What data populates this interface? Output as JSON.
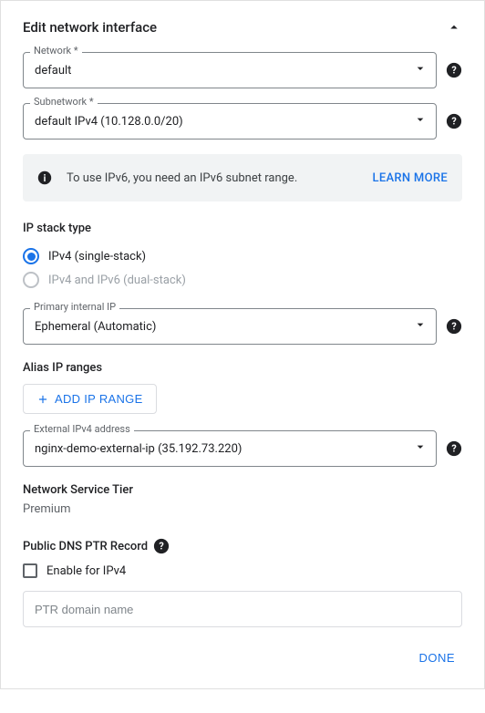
{
  "header": {
    "title": "Edit network interface"
  },
  "network": {
    "label": "Network *",
    "value": "default"
  },
  "subnetwork": {
    "label": "Subnetwork *",
    "value": "default IPv4 (10.128.0.0/20)"
  },
  "banner": {
    "text": "To use IPv6, you need an IPv6 subnet range.",
    "link": "LEARN MORE"
  },
  "ipStack": {
    "label": "IP stack type",
    "options": [
      {
        "label": "IPv4 (single-stack)",
        "selected": true,
        "disabled": false
      },
      {
        "label": "IPv4 and IPv6 (dual-stack)",
        "selected": false,
        "disabled": true
      }
    ]
  },
  "primaryInternal": {
    "label": "Primary internal IP",
    "value": "Ephemeral (Automatic)"
  },
  "aliasIp": {
    "label": "Alias IP ranges",
    "addButton": "ADD IP RANGE"
  },
  "externalIpv4": {
    "label": "External IPv4 address",
    "value": "nginx-demo-external-ip (35.192.73.220)"
  },
  "tier": {
    "label": "Network Service Tier",
    "value": "Premium"
  },
  "ptr": {
    "label": "Public DNS PTR Record",
    "checkbox": "Enable for IPv4",
    "placeholder": "PTR domain name"
  },
  "actions": {
    "done": "DONE"
  }
}
